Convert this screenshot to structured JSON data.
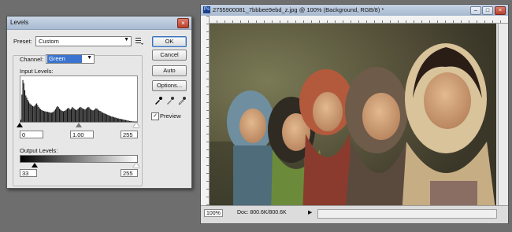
{
  "levels_dialog": {
    "title": "Levels",
    "close": "×",
    "preset_label": "Preset:",
    "preset_value": "Custom",
    "channel_label": "Channel:",
    "channel_value": "Green",
    "input_levels_label": "Input Levels:",
    "input_black": "0",
    "input_gamma": "1.00",
    "input_white": "255",
    "output_levels_label": "Output Levels:",
    "output_black": "33",
    "output_white": "255",
    "buttons": {
      "ok": "OK",
      "cancel": "Cancel",
      "auto": "Auto",
      "options": "Options..."
    },
    "preview_label": "Preview",
    "preview_checked": true,
    "histogram": [
      0.05,
      0.62,
      0.95,
      0.88,
      0.72,
      0.6,
      0.55,
      0.5,
      0.46,
      0.42,
      0.4,
      0.38,
      0.36,
      0.35,
      0.37,
      0.4,
      0.42,
      0.38,
      0.34,
      0.31,
      0.29,
      0.27,
      0.26,
      0.25,
      0.24,
      0.24,
      0.23,
      0.23,
      0.22,
      0.22,
      0.21,
      0.21,
      0.22,
      0.23,
      0.26,
      0.29,
      0.33,
      0.36,
      0.34,
      0.3,
      0.28,
      0.26,
      0.25,
      0.24,
      0.25,
      0.26,
      0.28,
      0.3,
      0.32,
      0.3,
      0.28,
      0.3,
      0.34,
      0.32,
      0.3,
      0.28,
      0.27,
      0.28,
      0.3,
      0.32,
      0.34,
      0.33,
      0.31,
      0.3,
      0.29,
      0.28,
      0.3,
      0.32,
      0.34,
      0.33,
      0.3,
      0.28,
      0.27,
      0.26,
      0.27,
      0.29,
      0.31,
      0.3,
      0.28,
      0.26,
      0.25,
      0.24,
      0.22,
      0.21,
      0.2,
      0.19,
      0.18,
      0.17,
      0.16,
      0.15,
      0.14,
      0.13,
      0.12,
      0.12,
      0.11,
      0.1,
      0.1,
      0.09,
      0.08,
      0.08,
      0.07,
      0.07,
      0.06,
      0.06,
      0.05,
      0.05,
      0.04,
      0.04,
      0.03,
      0.03,
      0.02,
      0.02,
      0.02,
      0.01,
      0.01,
      0.01,
      0.01,
      0.01
    ]
  },
  "document": {
    "title": "2755900081_7bbbee9ebd_z.jpg @ 100% (Background, RGB/8) *",
    "ps_badge": "Ps",
    "zoom": "100%",
    "doc_info": "Doc: 800.6K/800.6K",
    "window_buttons": {
      "minimize": "–",
      "maximize": "□",
      "close": "×"
    }
  },
  "colors": {
    "selection": "#3a74d0",
    "photo_background": "#4d4a39"
  }
}
